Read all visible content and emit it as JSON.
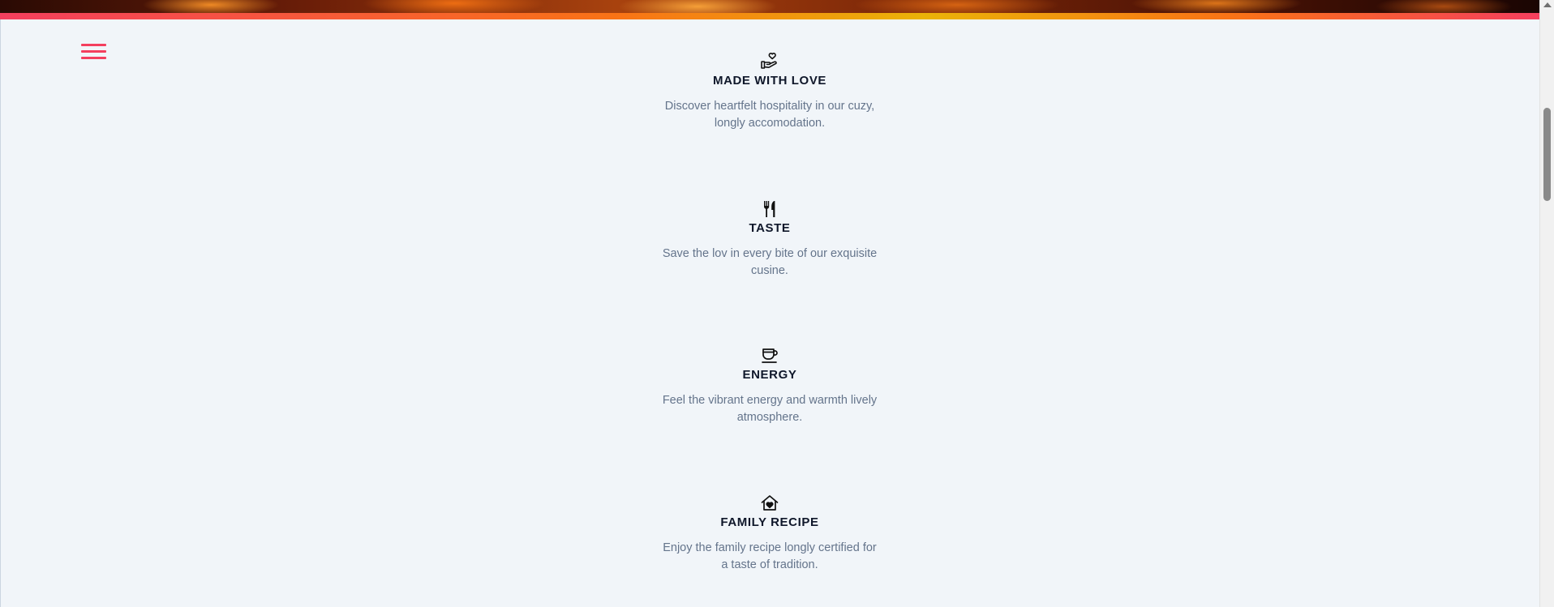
{
  "header": {
    "menu_icon": "hamburger-menu-icon",
    "accent_color": "#f43f5e"
  },
  "features": [
    {
      "icon": "hand-heart-icon",
      "title": "MADE WITH LOVE",
      "description": "Discover heartfelt hospitality in our cuzy, longly accomodation."
    },
    {
      "icon": "fork-knife-icon",
      "title": "TASTE",
      "description": "Save the lov in every bite of our exquisite cusine."
    },
    {
      "icon": "coffee-cup-icon",
      "title": "ENERGY",
      "description": "Feel the vibrant energy and warmth lively atmosphere."
    },
    {
      "icon": "house-heart-icon",
      "title": "FAMILY RECIPE",
      "description": "Enjoy the family recipe longly certified for a taste of tradition."
    }
  ]
}
